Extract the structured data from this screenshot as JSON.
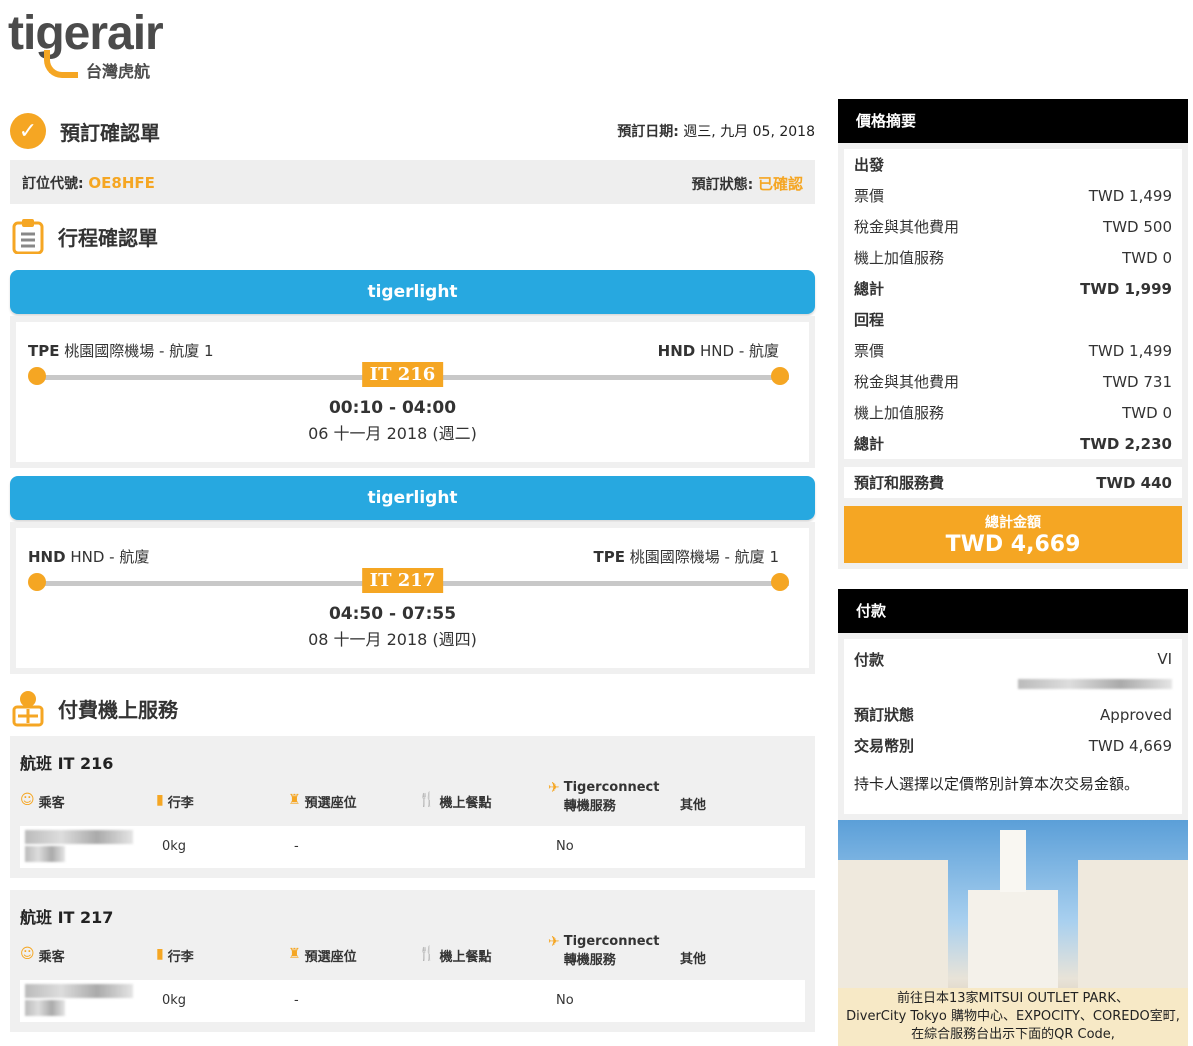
{
  "logo": {
    "word": "tigerair",
    "sub": "台灣虎航"
  },
  "confirm": {
    "title": "預訂確認單",
    "date_label": "預訂日期:",
    "date_value": "週三, 九月 05, 2018",
    "pnr_label": "訂位代號:",
    "pnr_value": "OE8HFE",
    "status_label": "預訂狀態:",
    "status_value": "已確認"
  },
  "itinerary": {
    "title": "行程確認單",
    "flights": [
      {
        "fare": "tigerlight",
        "from_code": "TPE",
        "from_name": "桃園國際機場 - 航廈 1",
        "to_code": "HND",
        "to_name": "HND - 航廈",
        "flight_no": "IT 216",
        "times": "00:10 - 04:00",
        "date": "06 十一月 2018 (週二)"
      },
      {
        "fare": "tigerlight",
        "from_code": "HND",
        "from_name": "HND - 航廈",
        "to_code": "TPE",
        "to_name": "桃園國際機場 - 航廈 1",
        "flight_no": "IT 217",
        "times": "04:50 - 07:55",
        "date": "08 十一月 2018 (週四)"
      }
    ]
  },
  "services": {
    "title": "付費機上服務",
    "columns": {
      "passenger": "乘客",
      "baggage": "行李",
      "seat": "預選座位",
      "meal": "機上餐點",
      "connect_1": "Tigerconnect",
      "connect_2": "轉機服務",
      "other": "其他"
    },
    "flights": [
      {
        "title": "航班 IT 216",
        "baggage": "0kg",
        "seat": "-",
        "connect": "No"
      },
      {
        "title": "航班 IT 217",
        "baggage": "0kg",
        "seat": "-",
        "connect": "No"
      }
    ]
  },
  "price": {
    "title": "價格摘要",
    "depart": {
      "label": "出發",
      "fare_label": "票價",
      "fare": "TWD 1,499",
      "tax_label": "稅金與其他費用",
      "tax": "TWD 500",
      "addon_label": "機上加值服務",
      "addon": "TWD 0",
      "total_label": "總計",
      "total": "TWD 1,999"
    },
    "return": {
      "label": "回程",
      "fare_label": "票價",
      "fare": "TWD 1,499",
      "tax_label": "稅金與其他費用",
      "tax": "TWD 731",
      "addon_label": "機上加值服務",
      "addon": "TWD 0",
      "total_label": "總計",
      "total": "TWD 2,230"
    },
    "booking_fee_label": "預訂和服務費",
    "booking_fee": "TWD 440",
    "grand_label": "總計金額",
    "grand_total": "TWD 4,669"
  },
  "payment": {
    "title": "付款",
    "method_label": "付款",
    "method_value": "VI",
    "status_label": "預訂狀態",
    "status_value": "Approved",
    "currency_label": "交易幣別",
    "currency_value": "TWD 4,669",
    "note": "持卡人選擇以定價幣別計算本次交易金額。"
  },
  "ad": {
    "line1": "前往日本13家MITSUI OUTLET PARK、",
    "line2": "DiverCity Tokyo 購物中心、EXPOCITY、COREDO室町,",
    "line3": "在綜合服務台出示下面的QR Code,"
  },
  "colors": {
    "accent": "#f5a623",
    "blue": "#27a8e0",
    "header": "#000000"
  }
}
